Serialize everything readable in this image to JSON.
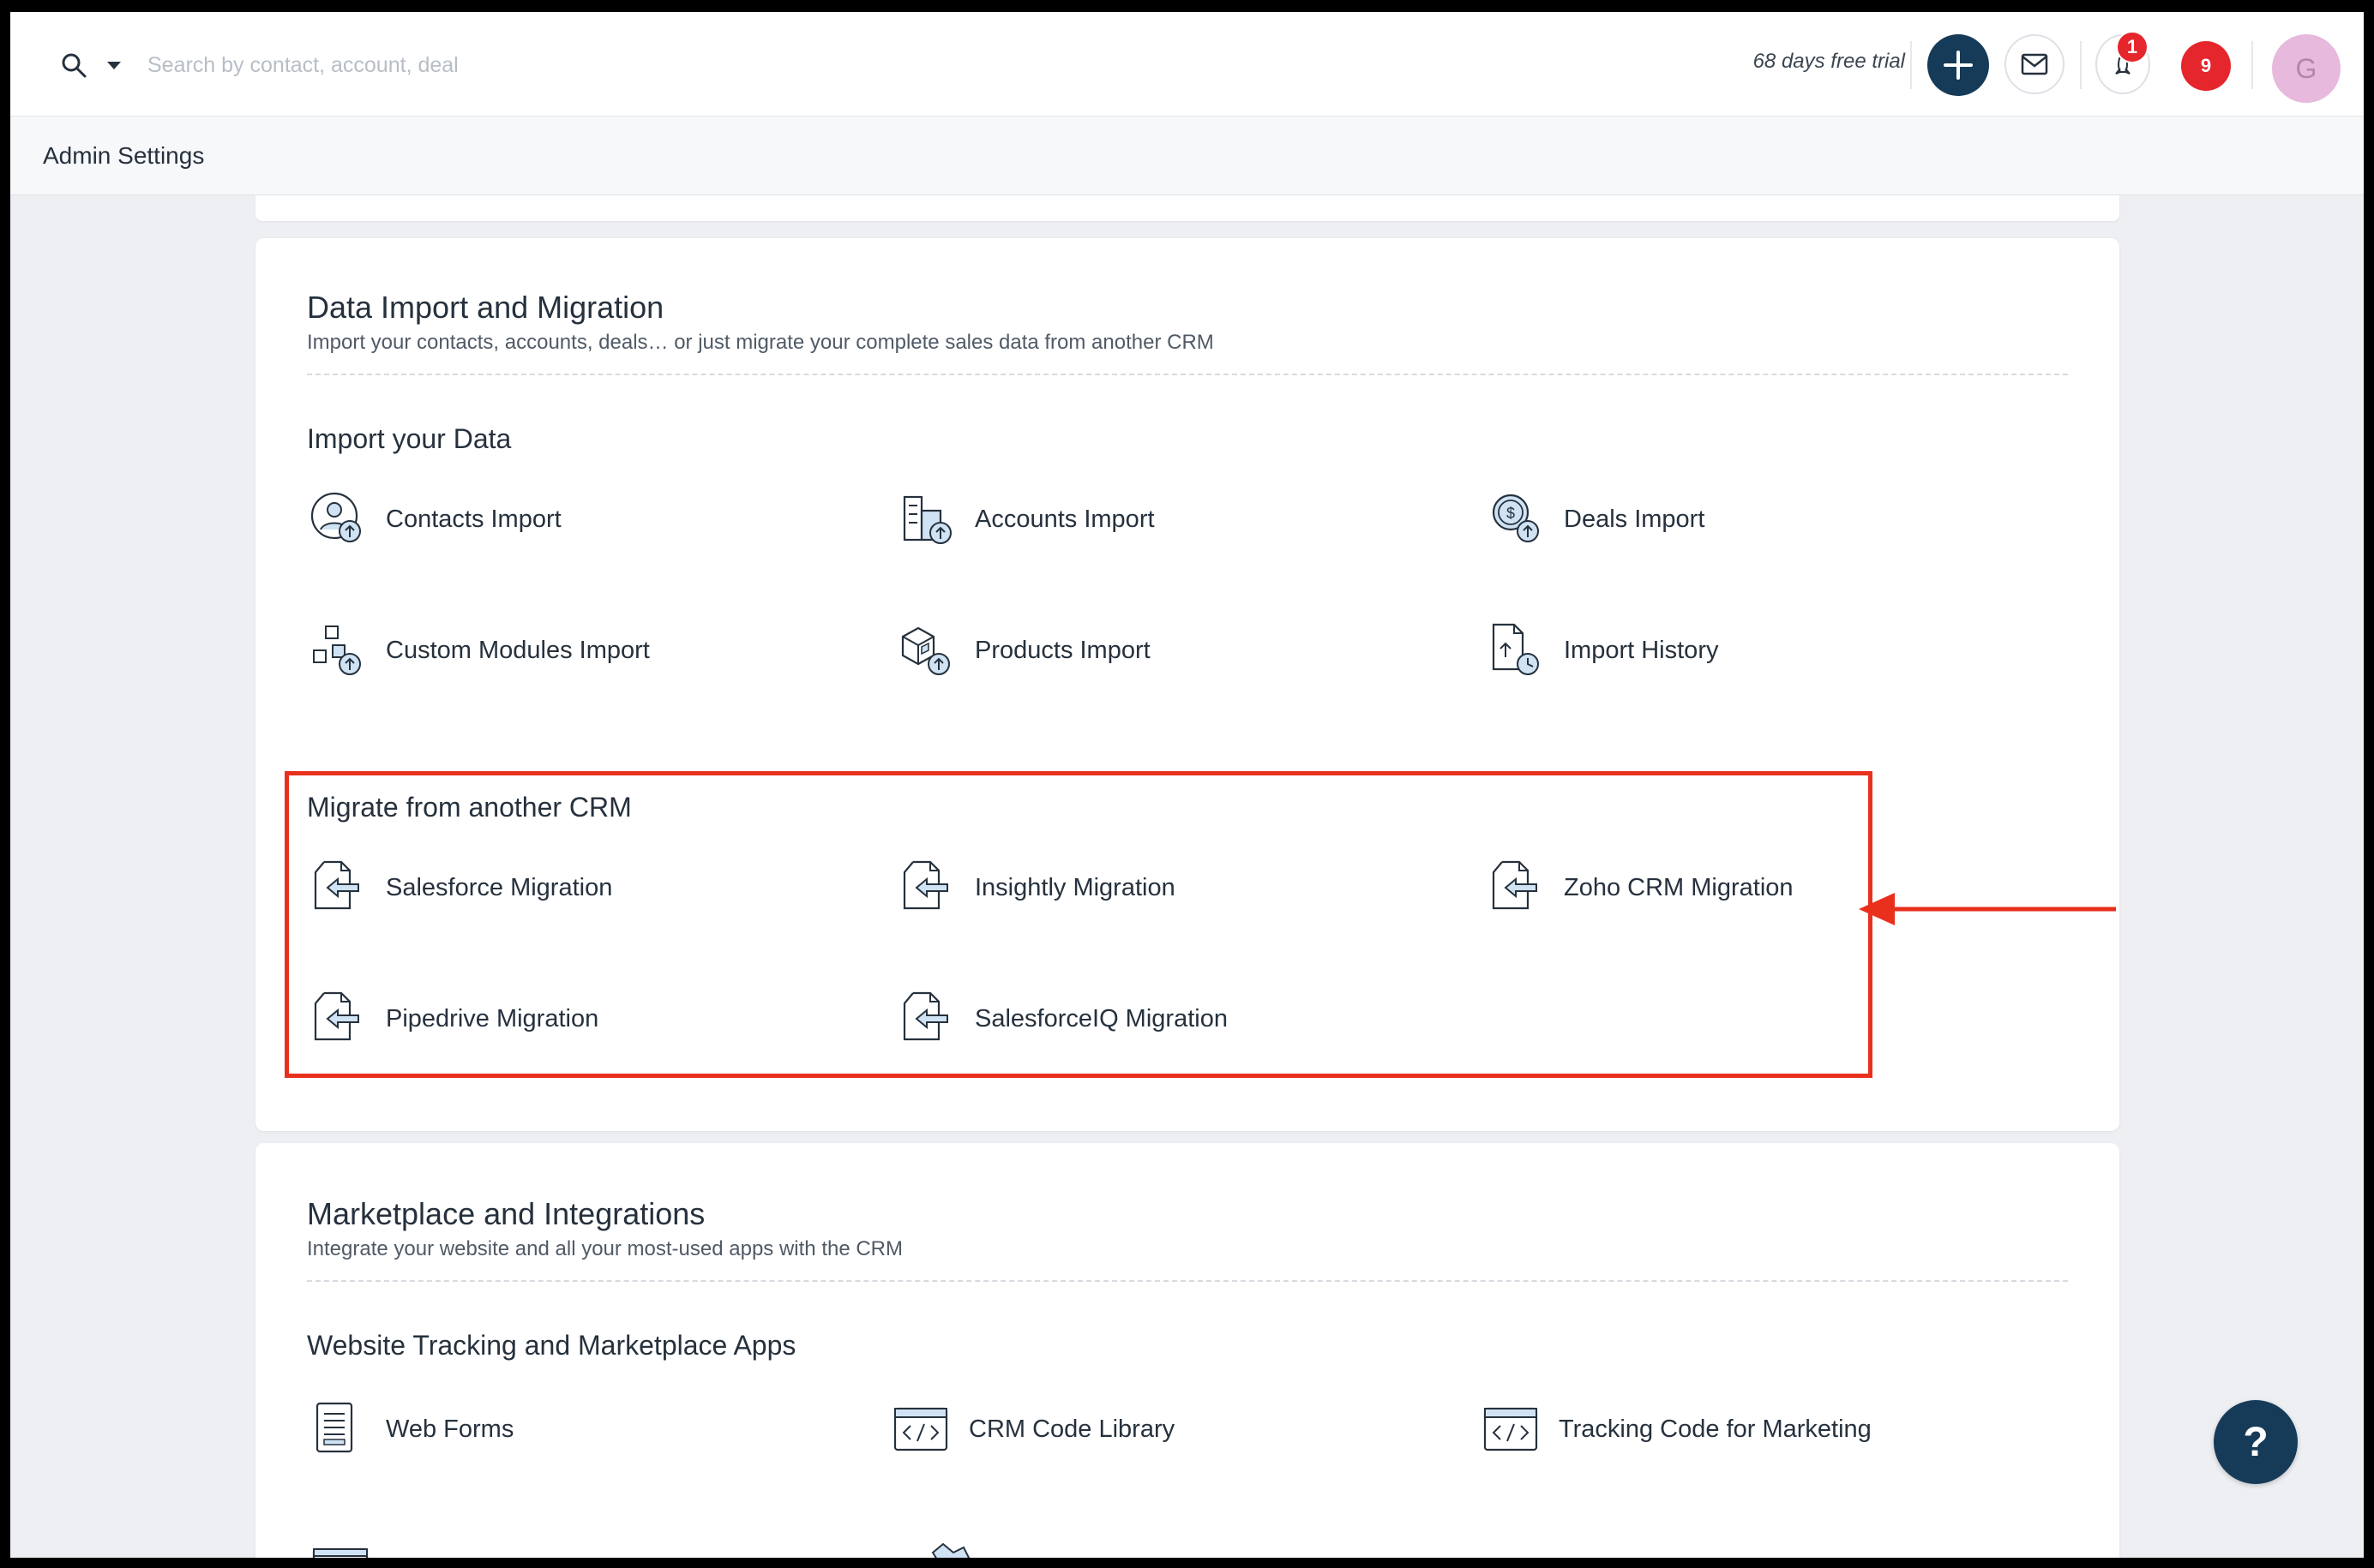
{
  "topbar": {
    "search_placeholder": "Search by contact, account, deal",
    "trial_text": "68 days free trial",
    "rocket_badge": "1",
    "notification_count": "9",
    "avatar_initial": "G"
  },
  "subheader": {
    "title": "Admin Settings"
  },
  "data_import": {
    "title": "Data Import and Migration",
    "subtitle": "Import your contacts, accounts, deals… or just migrate your complete sales data from another CRM",
    "import_section": {
      "title": "Import your Data",
      "items": [
        {
          "label": "Contacts Import",
          "icon": "contact-upload-icon"
        },
        {
          "label": "Accounts Import",
          "icon": "building-upload-icon"
        },
        {
          "label": "Deals Import",
          "icon": "dollar-upload-icon"
        },
        {
          "label": "Custom Modules Import",
          "icon": "modules-upload-icon"
        },
        {
          "label": "Products Import",
          "icon": "box-upload-icon"
        },
        {
          "label": "Import History",
          "icon": "file-clock-icon"
        }
      ]
    },
    "migrate_section": {
      "title": "Migrate from another CRM",
      "items": [
        {
          "label": "Salesforce Migration",
          "icon": "file-import-icon"
        },
        {
          "label": "Insightly Migration",
          "icon": "file-import-icon"
        },
        {
          "label": "Zoho CRM Migration",
          "icon": "file-import-icon"
        },
        {
          "label": "Pipedrive Migration",
          "icon": "file-import-icon"
        },
        {
          "label": "SalesforceIQ Migration",
          "icon": "file-import-icon"
        }
      ]
    }
  },
  "marketplace": {
    "title": "Marketplace and Integrations",
    "subtitle": "Integrate your website and all your most-used apps with the CRM",
    "tracking_section": {
      "title": "Website Tracking and Marketplace Apps",
      "items": [
        {
          "label": "Web Forms",
          "icon": "form-icon"
        },
        {
          "label": "CRM Code Library",
          "icon": "code-window-icon"
        },
        {
          "label": "Tracking Code for Marketing",
          "icon": "code-window-icon"
        }
      ]
    }
  },
  "help": {
    "label": "?"
  },
  "colors": {
    "primary": "#163b58",
    "badge": "#e5262d",
    "highlight": "#e8301c",
    "icon_fill": "#cfe3f5"
  }
}
